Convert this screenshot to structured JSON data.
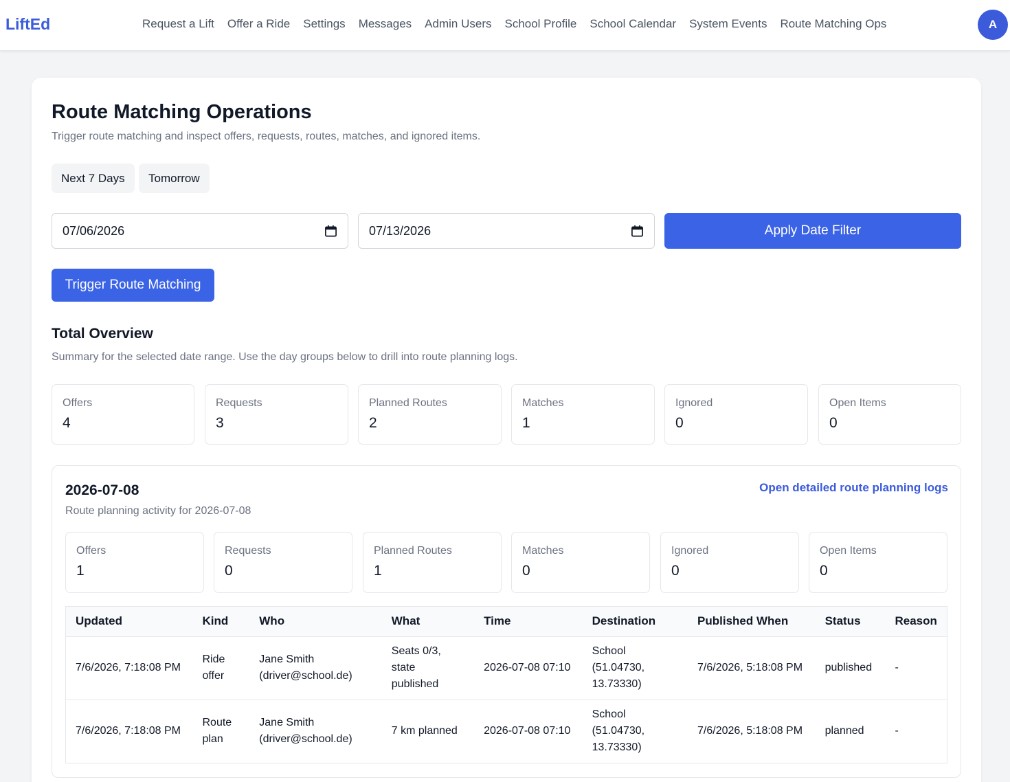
{
  "navbar": {
    "brand": "LiftEd",
    "links": [
      "Request a Lift",
      "Offer a Ride",
      "Settings",
      "Messages",
      "Admin Users",
      "School Profile",
      "School Calendar",
      "System Events",
      "Route Matching Ops"
    ],
    "avatar_initial": "A"
  },
  "page": {
    "title": "Route Matching Operations",
    "subtitle": "Trigger route matching and inspect offers, requests, routes, matches, and ignored items."
  },
  "quick_filters": [
    "Next 7 Days",
    "Tomorrow"
  ],
  "date_filter": {
    "from": "07/06/2026",
    "to": "07/13/2026",
    "apply_label": "Apply Date Filter"
  },
  "trigger_label": "Trigger Route Matching",
  "overview": {
    "title": "Total Overview",
    "subtitle": "Summary for the selected date range. Use the day groups below to drill into route planning logs.",
    "stats": [
      {
        "label": "Offers",
        "value": "4"
      },
      {
        "label": "Requests",
        "value": "3"
      },
      {
        "label": "Planned Routes",
        "value": "2"
      },
      {
        "label": "Matches",
        "value": "1"
      },
      {
        "label": "Ignored",
        "value": "0"
      },
      {
        "label": "Open Items",
        "value": "0"
      }
    ]
  },
  "day_group": {
    "date": "2026-07-08",
    "subtitle": "Route planning activity for 2026-07-08",
    "link_label": "Open detailed route planning logs",
    "stats": [
      {
        "label": "Offers",
        "value": "1"
      },
      {
        "label": "Requests",
        "value": "0"
      },
      {
        "label": "Planned Routes",
        "value": "1"
      },
      {
        "label": "Matches",
        "value": "0"
      },
      {
        "label": "Ignored",
        "value": "0"
      },
      {
        "label": "Open Items",
        "value": "0"
      }
    ],
    "table": {
      "headers": [
        "Updated",
        "Kind",
        "Who",
        "What",
        "Time",
        "Destination",
        "Published When",
        "Status",
        "Reason"
      ],
      "rows": [
        [
          "7/6/2026, 7:18:08 PM",
          "Ride offer",
          "Jane Smith (driver@school.de)",
          "Seats 0/3, state published",
          "2026-07-08 07:10",
          "School (51.04730, 13.73330)",
          "7/6/2026, 5:18:08 PM",
          "published",
          "-"
        ],
        [
          "7/6/2026, 7:18:08 PM",
          "Route plan",
          "Jane Smith (driver@school.de)",
          "7 km planned",
          "2026-07-08 07:10",
          "School (51.04730, 13.73330)",
          "7/6/2026, 5:18:08 PM",
          "planned",
          "-"
        ]
      ]
    }
  },
  "colors": {
    "brand": "#3b5bdb",
    "primary_button": "#3b63e6",
    "background": "#f3f4f6"
  },
  "icons": {
    "date_picker": "calendar-icon"
  }
}
